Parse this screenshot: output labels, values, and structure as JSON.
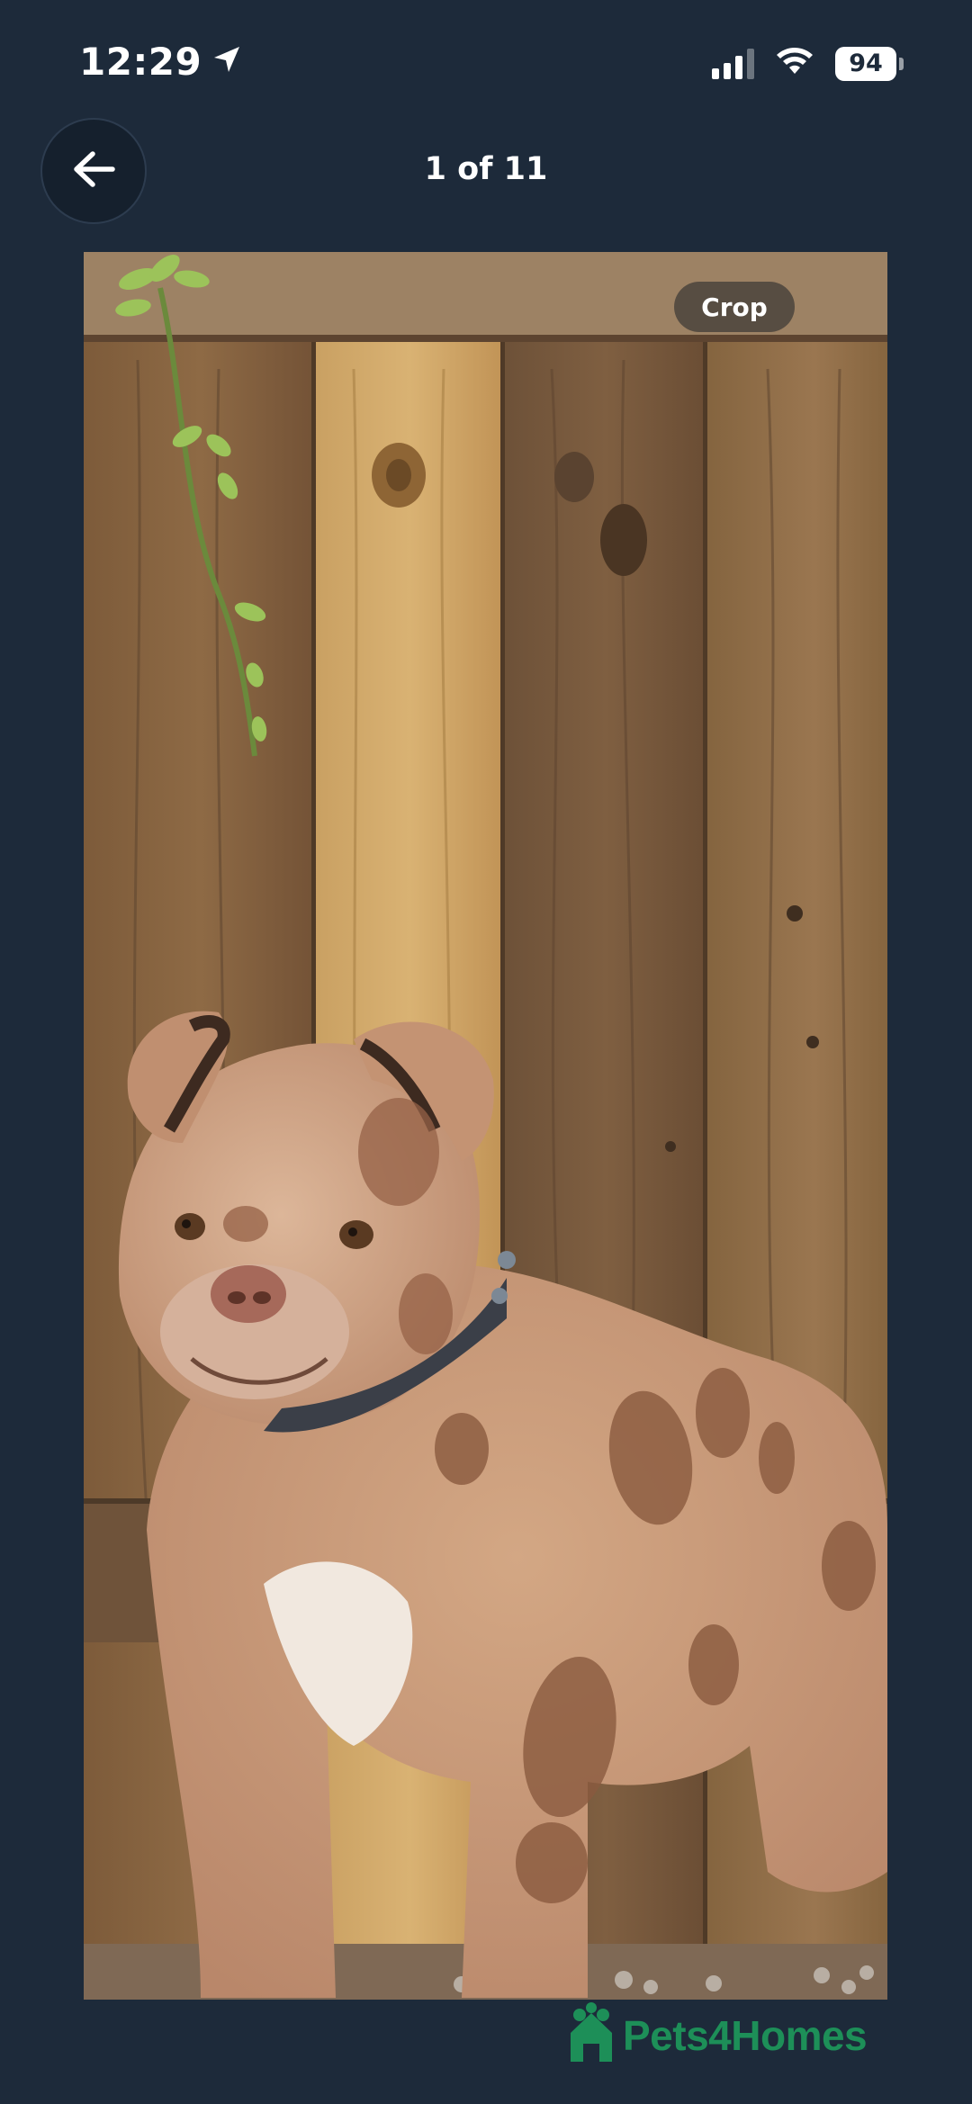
{
  "status_bar": {
    "time": "12:29",
    "battery_level": "94",
    "signal_bars_active": 3,
    "icons": [
      "location-arrow-icon",
      "cellular-signal-icon",
      "wifi-icon",
      "battery-icon"
    ]
  },
  "header": {
    "back_icon": "arrow-left-icon",
    "counter": "1 of 11"
  },
  "photo": {
    "subject": "dog",
    "crop_label": "Crop"
  },
  "watermark": {
    "brand": "Pets4Homes",
    "icon": "pets4homes-logo-icon"
  },
  "colors": {
    "background": "#1d2a3a",
    "brand_green": "#1d8f58",
    "text": "#ffffff"
  }
}
